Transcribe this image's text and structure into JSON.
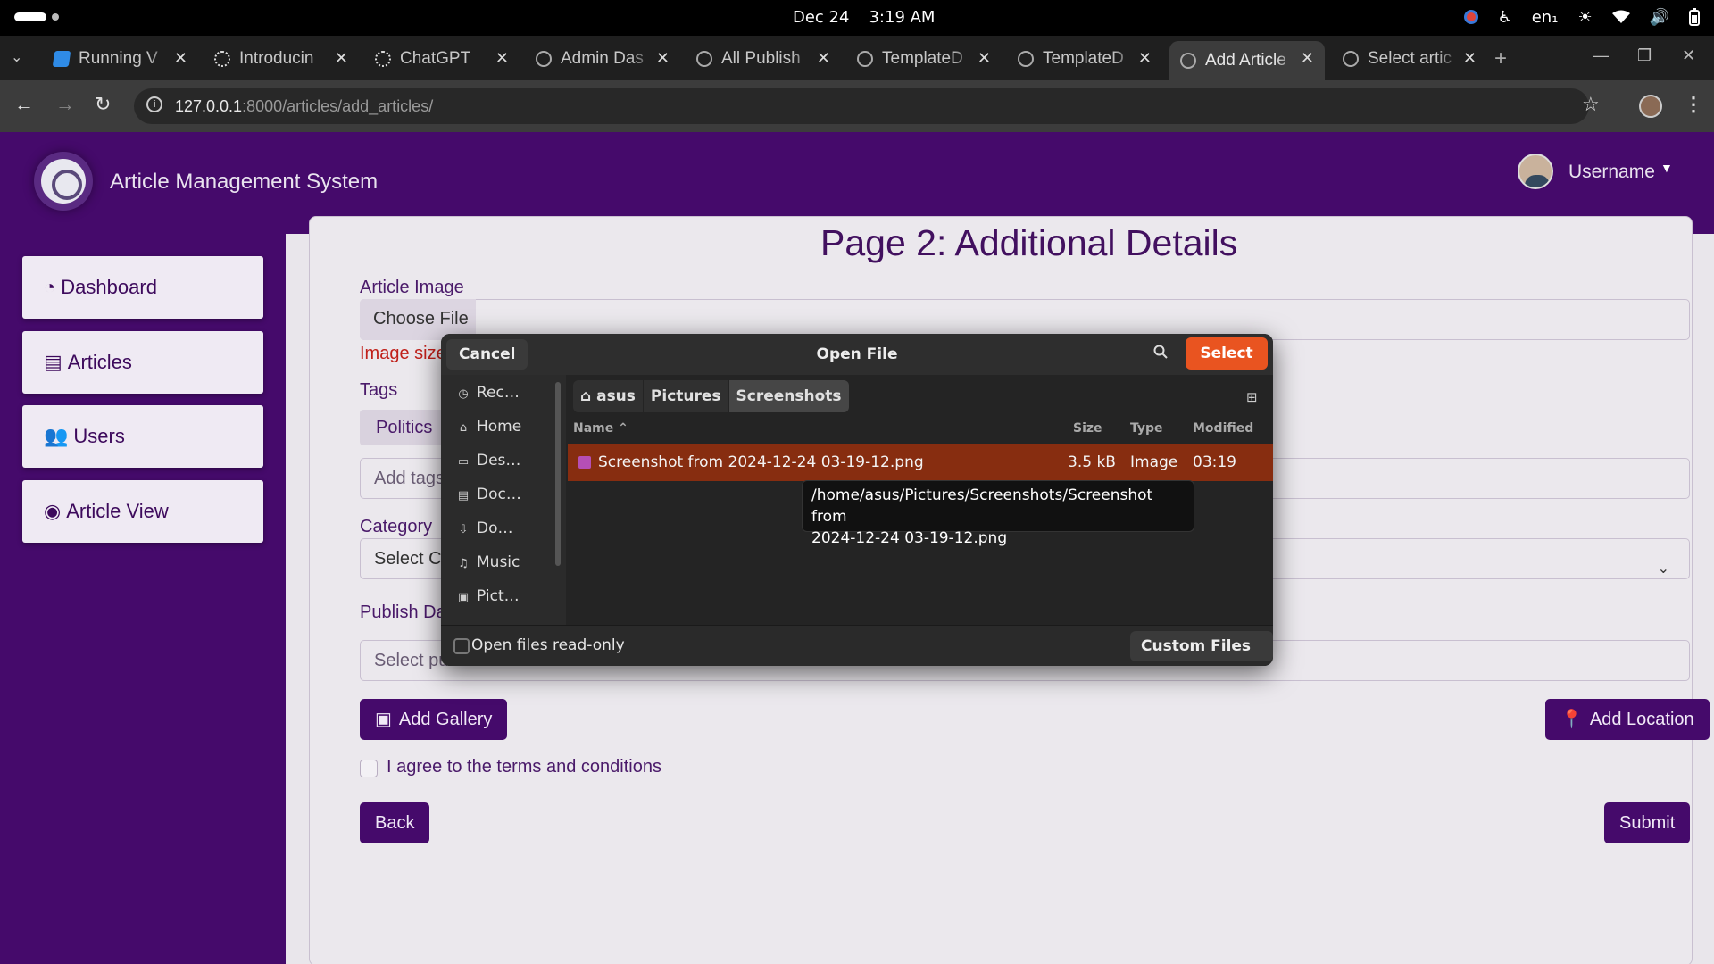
{
  "system_bar": {
    "date": "Dec 24",
    "time": "3:19 AM",
    "keyboard_layout": "en₁",
    "icons": [
      "screen-record-icon",
      "accessibility-icon",
      "brightness-icon",
      "wifi-icon",
      "volume-icon",
      "battery-icon"
    ]
  },
  "browser": {
    "tabs": [
      {
        "label": "Running V",
        "favicon": "vscode-icon"
      },
      {
        "label": "Introducin",
        "favicon": "openai-icon"
      },
      {
        "label": "ChatGPT",
        "favicon": "openai-icon"
      },
      {
        "label": "Admin Das",
        "favicon": "globe-icon"
      },
      {
        "label": "All Publish",
        "favicon": "globe-icon"
      },
      {
        "label": "TemplateD",
        "favicon": "globe-icon"
      },
      {
        "label": "TemplateD",
        "favicon": "globe-icon"
      },
      {
        "label": "Add Article",
        "favicon": "globe-icon",
        "active": true
      },
      {
        "label": "Select artic",
        "favicon": "globe-icon"
      }
    ],
    "url_host": "127.0.0.1",
    "url_rest": ":8000/articles/add_articles/"
  },
  "app": {
    "title": "Article Management System",
    "username": "Username",
    "sidebar": [
      {
        "label": "Dashboard",
        "icon": "dashboard-icon"
      },
      {
        "label": "Articles",
        "icon": "file-icon"
      },
      {
        "label": "Users",
        "icon": "users-icon"
      },
      {
        "label": "Article View",
        "icon": "eye-icon"
      }
    ]
  },
  "form": {
    "heading": "Page 2: Additional Details",
    "image_label": "Article Image",
    "choose_file": "Choose File",
    "image_error": "Image size is",
    "tags_label": "Tags",
    "tag_chips": [
      "Politics"
    ],
    "tags_placeholder": "Add tags (P",
    "category_label": "Category",
    "category_value": "Select Cate",
    "publish_label": "Publish Date",
    "publish_placeholder": "Select publish date",
    "add_gallery": "Add Gallery",
    "add_location": "Add Location",
    "terms": "I agree to the terms and conditions",
    "back": "Back",
    "submit": "Submit"
  },
  "dialog": {
    "title": "Open File",
    "cancel": "Cancel",
    "select": "Select",
    "places": [
      {
        "label": "Rec…",
        "icon": "clock-icon"
      },
      {
        "label": "Home",
        "icon": "home-icon"
      },
      {
        "label": "Des…",
        "icon": "desktop-icon"
      },
      {
        "label": "Doc…",
        "icon": "document-icon"
      },
      {
        "label": "Do…",
        "icon": "download-icon"
      },
      {
        "label": "Music",
        "icon": "music-icon"
      },
      {
        "label": "Pict…",
        "icon": "picture-icon"
      }
    ],
    "breadcrumb": [
      "asus",
      "Pictures",
      "Screenshots"
    ],
    "columns": {
      "name": "Name",
      "size": "Size",
      "type": "Type",
      "modified": "Modified"
    },
    "files": [
      {
        "name": "Screenshot from 2024-12-24 03-19-12.png",
        "size": "3.5 kB",
        "type": "Image",
        "modified": "03:19"
      }
    ],
    "tooltip_line1": "/home/asus/Pictures/Screenshots/Screenshot from",
    "tooltip_line2": "2024-12-24 03-19-12.png",
    "read_only_label": "Open files read-only",
    "filter": "Custom Files"
  }
}
